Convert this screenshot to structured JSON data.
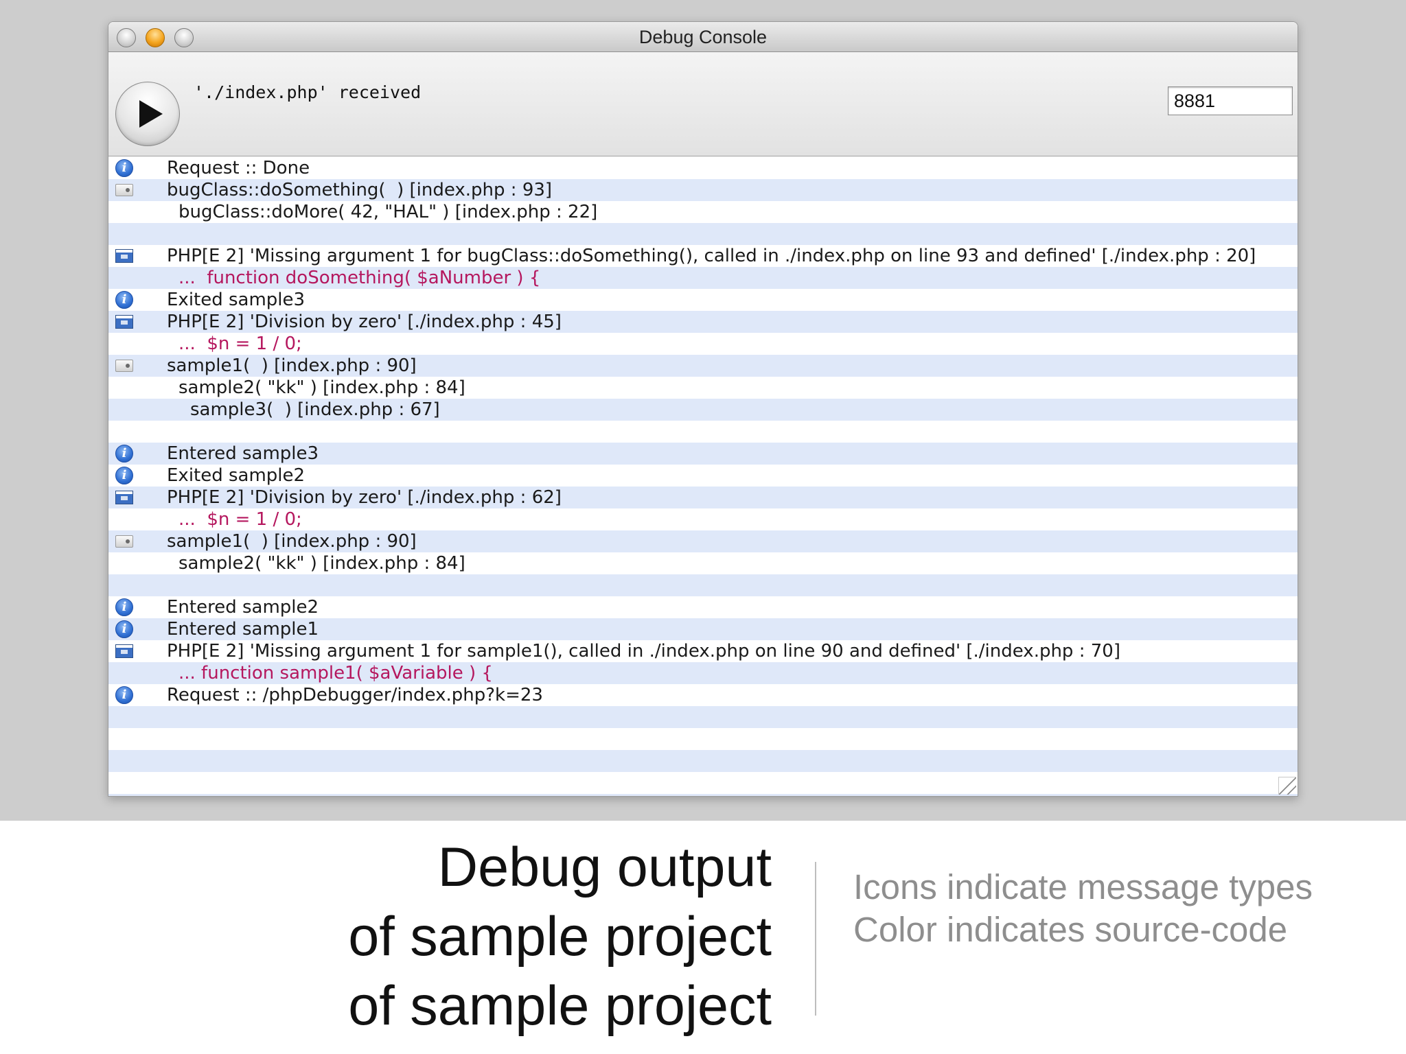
{
  "window": {
    "title": "Debug Console",
    "status_text": "'./index.php' received",
    "port_value": "8881"
  },
  "log": [
    {
      "icon": "info-icon",
      "kind": "msg",
      "indent": 0,
      "text": "Request :: Done"
    },
    {
      "icon": "trace-icon",
      "kind": "msg",
      "indent": 0,
      "text": "bugClass::doSomething(  ) [index.php : 93]"
    },
    {
      "icon": "",
      "kind": "msg",
      "indent": 1,
      "text": "bugClass::doMore( 42, \"HAL\" ) [index.php : 22]"
    },
    {
      "icon": "",
      "kind": "msg",
      "indent": 0,
      "text": ""
    },
    {
      "icon": "error-icon",
      "kind": "msg",
      "indent": 0,
      "text": "PHP[E 2] 'Missing argument 1 for bugClass::doSomething(), called in ./index.php on line 93 and defined' [./index.php : 20]"
    },
    {
      "icon": "",
      "kind": "code",
      "indent": 1,
      "text": "...  function doSomething( $aNumber ) {"
    },
    {
      "icon": "info-icon",
      "kind": "msg",
      "indent": 0,
      "text": "Exited sample3"
    },
    {
      "icon": "error-icon",
      "kind": "msg",
      "indent": 0,
      "text": "PHP[E 2] 'Division by zero' [./index.php : 45]"
    },
    {
      "icon": "",
      "kind": "code",
      "indent": 1,
      "text": "...  $n = 1 / 0;"
    },
    {
      "icon": "trace-icon",
      "kind": "msg",
      "indent": 0,
      "text": "sample1(  ) [index.php : 90]"
    },
    {
      "icon": "",
      "kind": "msg",
      "indent": 1,
      "text": "sample2( \"kk\" ) [index.php : 84]"
    },
    {
      "icon": "",
      "kind": "msg",
      "indent": 2,
      "text": "sample3(  ) [index.php : 67]"
    },
    {
      "icon": "",
      "kind": "msg",
      "indent": 0,
      "text": ""
    },
    {
      "icon": "info-icon",
      "kind": "msg",
      "indent": 0,
      "text": "Entered sample3"
    },
    {
      "icon": "info-icon",
      "kind": "msg",
      "indent": 0,
      "text": "Exited sample2"
    },
    {
      "icon": "error-icon",
      "kind": "msg",
      "indent": 0,
      "text": "PHP[E 2] 'Division by zero' [./index.php : 62]"
    },
    {
      "icon": "",
      "kind": "code",
      "indent": 1,
      "text": "...  $n = 1 / 0;"
    },
    {
      "icon": "trace-icon",
      "kind": "msg",
      "indent": 0,
      "text": "sample1(  ) [index.php : 90]"
    },
    {
      "icon": "",
      "kind": "msg",
      "indent": 1,
      "text": "sample2( \"kk\" ) [index.php : 84]"
    },
    {
      "icon": "",
      "kind": "msg",
      "indent": 0,
      "text": ""
    },
    {
      "icon": "info-icon",
      "kind": "msg",
      "indent": 0,
      "text": "Entered sample2"
    },
    {
      "icon": "info-icon",
      "kind": "msg",
      "indent": 0,
      "text": "Entered sample1"
    },
    {
      "icon": "error-icon",
      "kind": "msg",
      "indent": 0,
      "text": "PHP[E 2] 'Missing argument 1 for sample1(), called in ./index.php on line 90 and defined' [./index.php : 70]"
    },
    {
      "icon": "",
      "kind": "code",
      "indent": 1,
      "text": "... function sample1( $aVariable ) {"
    },
    {
      "icon": "info-icon",
      "kind": "msg",
      "indent": 0,
      "text": "Request :: /phpDebugger/index.php?k=23"
    },
    {
      "icon": "",
      "kind": "msg",
      "indent": 0,
      "text": ""
    },
    {
      "icon": "",
      "kind": "msg",
      "indent": 0,
      "text": ""
    },
    {
      "icon": "",
      "kind": "msg",
      "indent": 0,
      "text": ""
    },
    {
      "icon": "",
      "kind": "msg",
      "indent": 0,
      "text": ""
    },
    {
      "icon": "",
      "kind": "msg",
      "indent": 0,
      "text": ""
    }
  ],
  "caption": {
    "left_lines": [
      "Debug output",
      "of sample project",
      "of sample project"
    ],
    "right_lines": [
      "Icons indicate message types",
      "Color indicates source-code"
    ]
  }
}
